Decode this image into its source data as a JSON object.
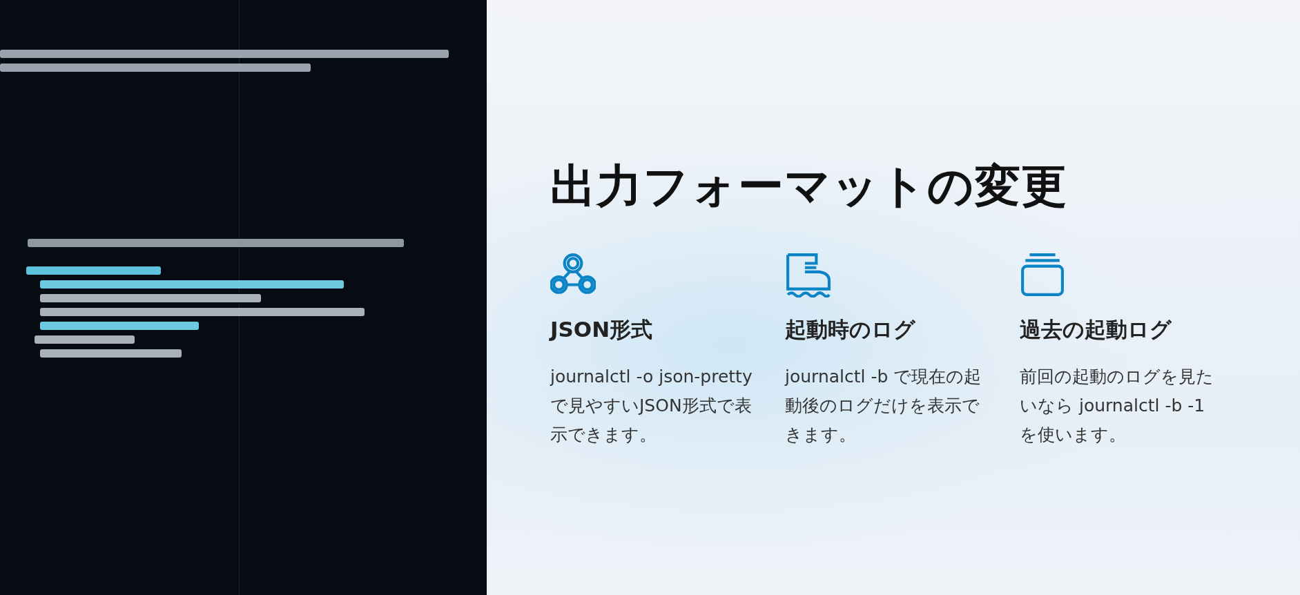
{
  "title": "出力フォーマットの変更",
  "features": [
    {
      "heading": "JSON形式",
      "text": "journalctl -o json-pretty で見やすいJSON形式で表示できます。"
    },
    {
      "heading": "起動時のログ",
      "text": "journalctl -b で現在の起動後のログだけを表示できます。"
    },
    {
      "heading": "過去の起動ログ",
      "text": "前回の起動のログを見たいなら journalctl -b -1 を使います。"
    }
  ]
}
